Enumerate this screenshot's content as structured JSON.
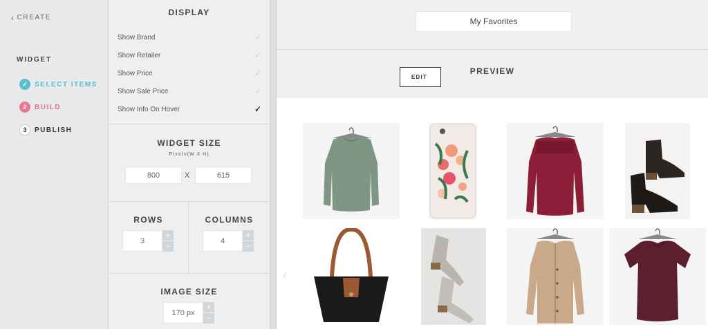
{
  "nav": {
    "back_label": "CREATE",
    "widget_title": "WIDGET",
    "steps": [
      {
        "num": "✓",
        "label": "SELECT ITEMS"
      },
      {
        "num": "2",
        "label": "BUILD"
      },
      {
        "num": "3",
        "label": "PUBLISH"
      }
    ]
  },
  "settings": {
    "display": {
      "title": "DISPLAY",
      "options": [
        {
          "label": "Show Brand",
          "checked": false
        },
        {
          "label": "Show Retailer",
          "checked": false
        },
        {
          "label": "Show Price",
          "checked": false
        },
        {
          "label": "Show Sale Price",
          "checked": false
        },
        {
          "label": "Show Info On Hover",
          "checked": true
        }
      ]
    },
    "widget_size": {
      "title": "WIDGET SIZE",
      "subtitle": "Pixels(W X H)",
      "width": "800",
      "separator": "X",
      "height": "615"
    },
    "rows": {
      "title": "ROWS",
      "value": "3"
    },
    "columns": {
      "title": "COLUMNS",
      "value": "4"
    },
    "image_size": {
      "title": "IMAGE SIZE",
      "value": "170 px"
    },
    "stepper": {
      "plus": "+",
      "minus": "−"
    }
  },
  "preview": {
    "widget_name": "My Favorites",
    "title": "PREVIEW",
    "edit_label": "EDIT",
    "prev_arrow": "‹",
    "items": [
      "sage-green-sweater",
      "floral-phone-case",
      "burgundy-sweater",
      "black-ankle-bootie",
      "black-tote-bag",
      "grey-suede-bootie",
      "tan-cardigan",
      "burgundy-tee"
    ]
  },
  "colors": {
    "accent_teal": "#5bbccb",
    "accent_pink": "#e97a8d",
    "sage": "#7f9684",
    "burgundy": "#8c1f37",
    "plum": "#5c1f2e"
  }
}
